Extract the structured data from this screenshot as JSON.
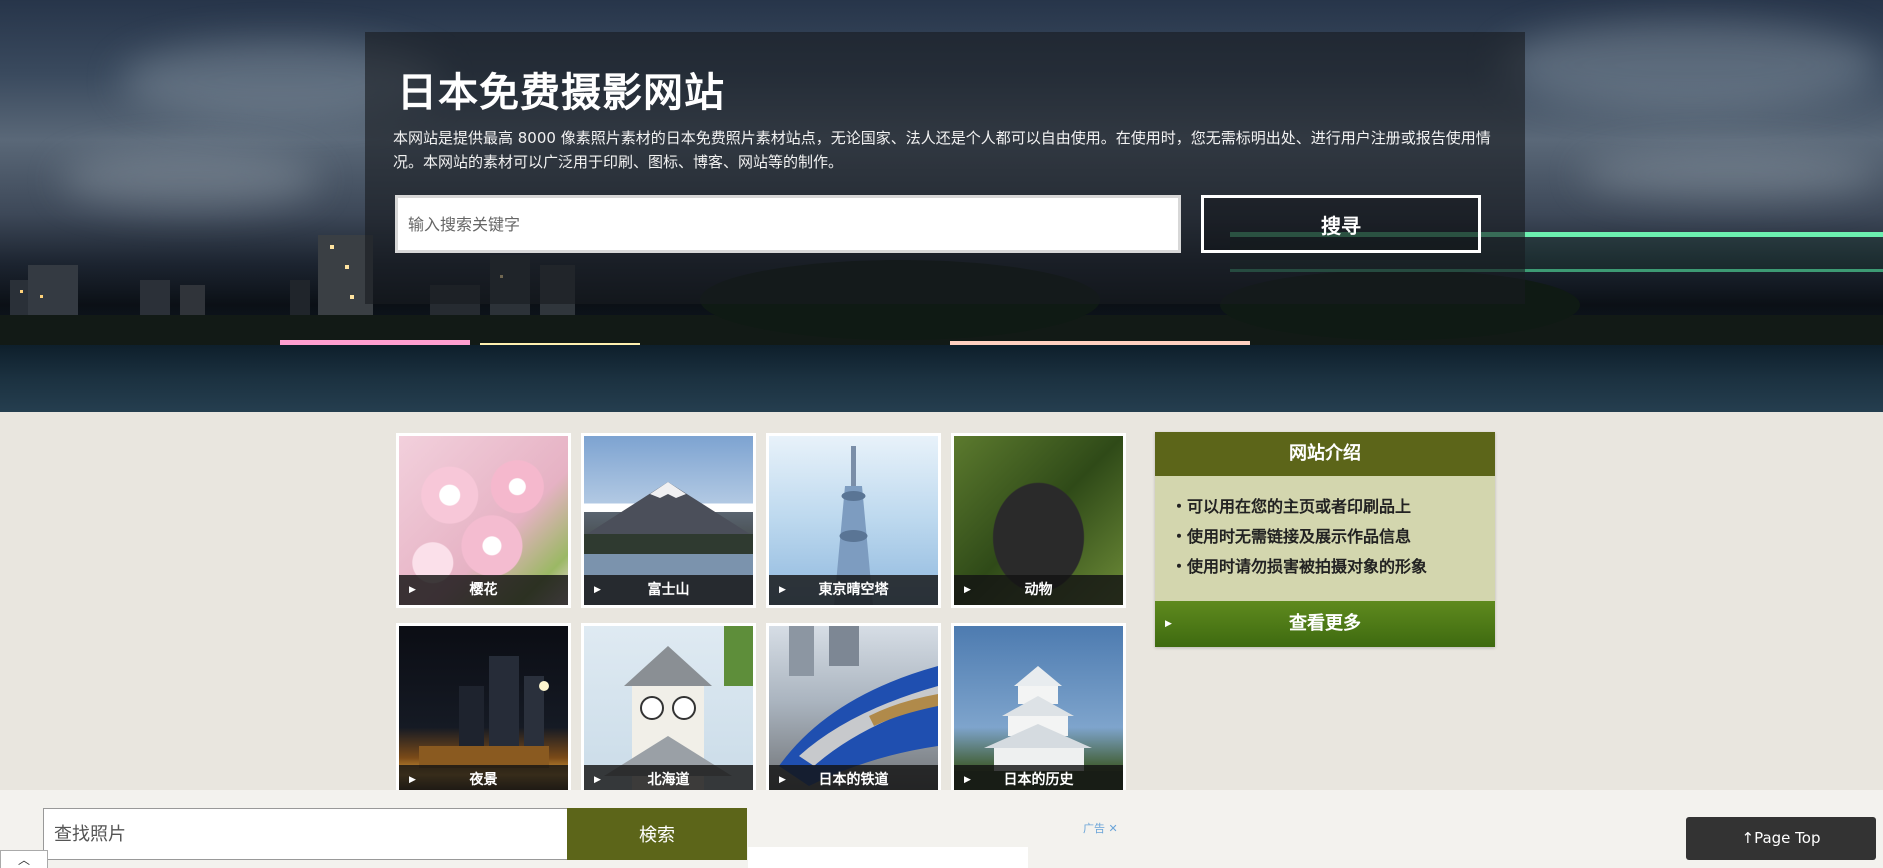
{
  "hero": {
    "title": "日本免费摄影网站",
    "description": "本网站是提供最高 8000 像素照片素材的日本免费照片素材站点，无论国家、法人还是个人都可以自由使用。在使用时，您无需标明出处、进行用户注册或报告使用情况。本网站的素材可以广泛用于印刷、图标、博客、网站等的制作。",
    "search_placeholder": "输入搜索关键字",
    "search_button": "搜寻"
  },
  "categories": [
    {
      "label": "樱花",
      "icon": "cherry-blossom-photo"
    },
    {
      "label": "富士山",
      "icon": "mount-fuji-photo"
    },
    {
      "label": "東京晴空塔",
      "icon": "tokyo-skytree-photo"
    },
    {
      "label": "动物",
      "icon": "cat-photo"
    },
    {
      "label": "夜景",
      "icon": "night-view-photo"
    },
    {
      "label": "北海道",
      "icon": "clock-tower-photo"
    },
    {
      "label": "日本的铁道",
      "icon": "bullet-train-photo"
    },
    {
      "label": "日本的历史",
      "icon": "castle-photo"
    }
  ],
  "sidebar": {
    "title": "网站介绍",
    "items": [
      "可以用在您的主页或者印刷品上",
      "使用时无需链接及展示作品信息",
      "使用时请勿损害被拍摄对象的形象"
    ],
    "more": "查看更多"
  },
  "bottom": {
    "search_placeholder": "查找照片",
    "search_button": "検索",
    "ad_label": "广告 ✕",
    "collapse": "︿",
    "page_top": "↑Page Top"
  },
  "colors": {
    "accent": "#5c6519",
    "sidebar_bg": "#d3d6ae",
    "more_button": "#4f7a17"
  }
}
